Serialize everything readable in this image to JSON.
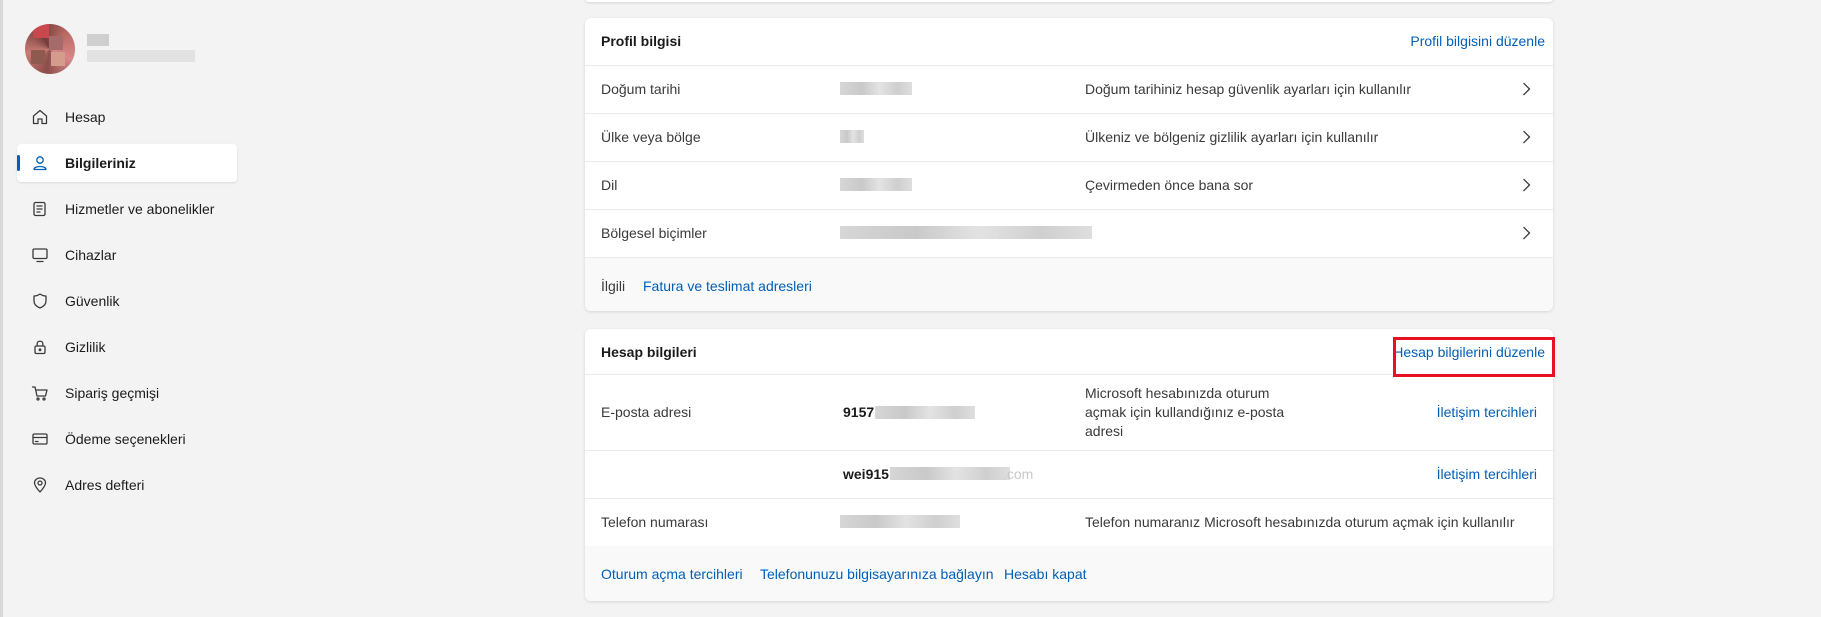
{
  "sidebar": {
    "items": [
      {
        "label": "Hesap",
        "icon": "home-icon"
      },
      {
        "label": "Bilgileriniz",
        "icon": "person-icon",
        "active": true
      },
      {
        "label": "Hizmetler ve abonelikler",
        "icon": "subscription-icon"
      },
      {
        "label": "Cihazlar",
        "icon": "monitor-icon"
      },
      {
        "label": "Güvenlik",
        "icon": "shield-icon"
      },
      {
        "label": "Gizlilik",
        "icon": "lock-icon"
      },
      {
        "label": "Sipariş geçmişi",
        "icon": "cart-icon"
      },
      {
        "label": "Ödeme seçenekleri",
        "icon": "card-icon"
      },
      {
        "label": "Adres defteri",
        "icon": "location-icon"
      }
    ]
  },
  "profile": {
    "title": "Profil bilgisi",
    "edit_link": "Profil bilgisini düzenle",
    "rows": [
      {
        "label": "Doğum tarihi",
        "description": "Doğum tarihiniz hesap güvenlik ayarları için kullanılır"
      },
      {
        "label": "Ülke veya bölge",
        "description": "Ülkeniz ve bölgeniz gizlilik ayarları için kullanılır"
      },
      {
        "label": "Dil",
        "description": "Çevirmeden önce bana sor"
      },
      {
        "label": "Bölgesel biçimler",
        "description": ""
      }
    ],
    "related_label": "İlgili",
    "related_link": "Fatura ve teslimat adresleri"
  },
  "account": {
    "title": "Hesap bilgileri",
    "edit_link": "Hesap bilgilerini düzenle",
    "email_label": "E-posta adresi",
    "email_1_prefix": "9157",
    "email_desc": "Microsoft hesabınızda oturum açmak için kullandığınız e-posta adresi",
    "contact_pref_1": "İletişim tercihleri",
    "email_2_prefix": "wei915",
    "email_2_suffix": ".com",
    "contact_pref_2": "İletişim tercihleri",
    "phone_label": "Telefon numarası",
    "phone_desc": "Telefon numaranız Microsoft hesabınızda oturum açmak için kullanılır",
    "footer_links": [
      "Oturum açma tercihleri",
      "Telefonunuzu bilgisayarınıza bağlayın",
      "Hesabı kapat"
    ]
  },
  "colors": {
    "accent": "#005fb8",
    "highlight_box": "#e81123"
  }
}
